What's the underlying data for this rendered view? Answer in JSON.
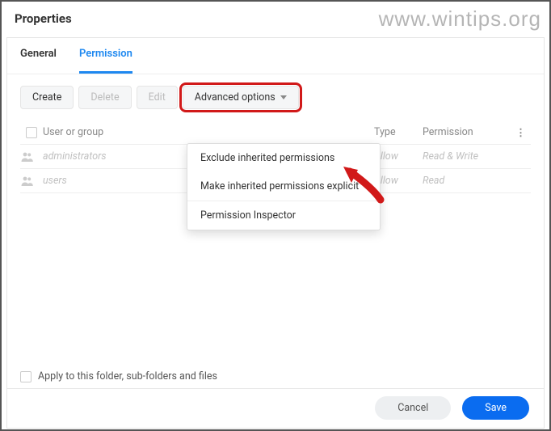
{
  "watermark": "www.wintips.org",
  "header": {
    "title": "Properties"
  },
  "tabs": [
    {
      "label": "General",
      "active": false
    },
    {
      "label": "Permission",
      "active": true
    }
  ],
  "toolbar": {
    "create": "Create",
    "delete": "Delete",
    "edit": "Edit",
    "adv": "Advanced options"
  },
  "columns": {
    "user": "User or group",
    "type": "Type",
    "perm": "Permission",
    "more": "⋮"
  },
  "rows": [
    {
      "name": "administrators",
      "type": "Allow",
      "perm": "Read & Write"
    },
    {
      "name": "users",
      "type": "Allow",
      "perm": "Read"
    }
  ],
  "dropdown": {
    "item1": "Exclude inherited permissions",
    "item2": "Make inherited permissions explicit",
    "item3": "Permission Inspector"
  },
  "applyLabel": "Apply to this folder, sub-folders and files",
  "footer": {
    "cancel": "Cancel",
    "save": "Save"
  }
}
